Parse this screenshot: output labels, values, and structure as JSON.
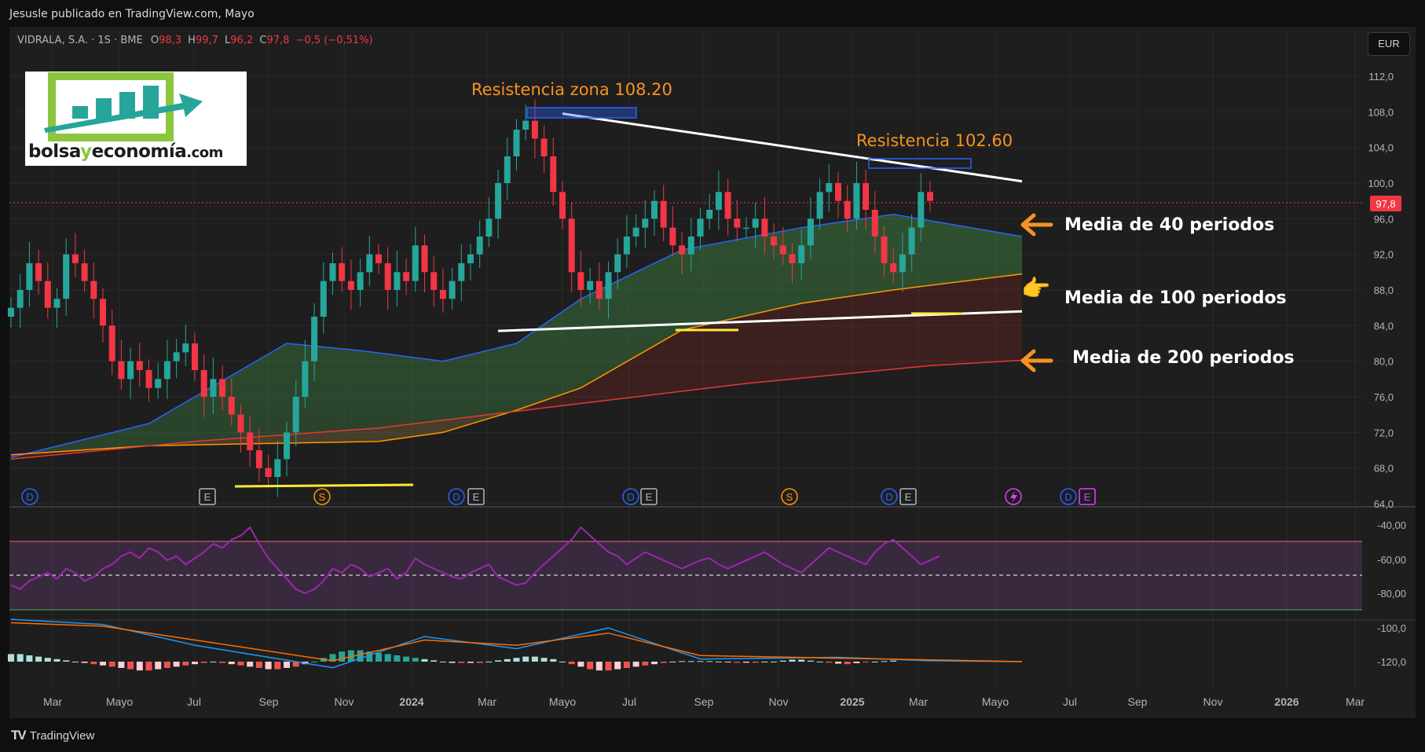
{
  "publisher_line": "Jesusle publicado en TradingView.com, Mayo",
  "brand": {
    "logo": "TV",
    "name": "TradingView"
  },
  "symbol_line": {
    "name": "VIDRALA, S.A. · 1S · BME",
    "o_label": "O",
    "o": "98,3",
    "h_label": "H",
    "h": "99,7",
    "l_label": "L",
    "l": "96,2",
    "c_label": "C",
    "c": "97,8",
    "chg": "−0,5 (−0,51%)"
  },
  "currency": "EUR",
  "logo": {
    "word1": "bolsa",
    "word2": "y",
    "word3": "economía",
    "word4": ".com"
  },
  "annotations": {
    "res1": "Resistencia zona 108.20",
    "res2": "Resistencia 102.60",
    "ma40": "Media de 40 periodos",
    "ma100": "Media de 100 periodos",
    "ma200": "Media de 200 periodos"
  },
  "colors": {
    "up": "#26a69a",
    "down": "#f23645",
    "ma40": "#2962ff",
    "ma100": "#ff9800",
    "ma200": "#e53935",
    "rsi": "#9c27b0",
    "macd": "#2196f3",
    "signal": "#ff6d00",
    "annotation": "#f7931e",
    "price_tag": "#f23645"
  },
  "chart_data": [
    {
      "type": "candlestick",
      "title": "VIDRALA, S.A. · 1S · BME",
      "last_price": "97,8",
      "y_axis": {
        "ticks": [
          "112,0",
          "108,0",
          "104,0",
          "100,0",
          "96,0",
          "92,0",
          "88,0",
          "84,0",
          "80,0",
          "76,0",
          "72,0",
          "68,0",
          "64,0"
        ],
        "range": [
          64,
          112
        ]
      },
      "x_axis": {
        "ticks": [
          "Mar",
          "Mayo",
          "Jul",
          "Sep",
          "Nov",
          "2024",
          "Mar",
          "Mayo",
          "Jul",
          "Sep",
          "Nov",
          "2025",
          "Mar",
          "Mayo",
          "Jul",
          "Sep",
          "Nov",
          "2026",
          "Mar"
        ],
        "bold": [
          "2024",
          "2025",
          "2026"
        ]
      },
      "closes": [
        86,
        88,
        91,
        89,
        86,
        87,
        92,
        91,
        89,
        87,
        84,
        80,
        78,
        80,
        79,
        77,
        78,
        80,
        81,
        82,
        79,
        76,
        78,
        76,
        74,
        72,
        70,
        68,
        67,
        69,
        72,
        76,
        80,
        85,
        89,
        91,
        89,
        88,
        90,
        92,
        91,
        88,
        90,
        89,
        93,
        90,
        88,
        87,
        89,
        91,
        92,
        94,
        96,
        100,
        103,
        106,
        107,
        105,
        103,
        99,
        96,
        90,
        88,
        89,
        87,
        90,
        92,
        94,
        95,
        96,
        98,
        95,
        93,
        92,
        94,
        96,
        97,
        99,
        96,
        95,
        95,
        96,
        94,
        93,
        92,
        91,
        93,
        96,
        99,
        100,
        98,
        96,
        100,
        97,
        94,
        91,
        90,
        92,
        95,
        99,
        98
      ],
      "moving_averages": [
        {
          "name": "MA 40",
          "points": [
            [
              0,
              69.2
            ],
            [
              15,
              73
            ],
            [
              30,
              82
            ],
            [
              38,
              81.2
            ],
            [
              47,
              80
            ],
            [
              55,
              82
            ],
            [
              62,
              87
            ],
            [
              73,
              92.5
            ],
            [
              86,
              95
            ],
            [
              96,
              96.5
            ],
            [
              110,
              94
            ]
          ]
        },
        {
          "name": "MA 100",
          "points": [
            [
              0,
              69.5
            ],
            [
              15,
              70.5
            ],
            [
              30,
              70.8
            ],
            [
              40,
              71
            ],
            [
              47,
              72
            ],
            [
              55,
              74.5
            ],
            [
              62,
              77
            ],
            [
              73,
              83.5
            ],
            [
              86,
              86.5
            ],
            [
              96,
              88
            ],
            [
              110,
              89.8
            ]
          ]
        },
        {
          "name": "MA 200",
          "points": [
            [
              0,
              69
            ],
            [
              20,
              71
            ],
            [
              40,
              72.5
            ],
            [
              60,
              75
            ],
            [
              80,
              77.5
            ],
            [
              100,
              79.5
            ],
            [
              110,
              80.1
            ]
          ]
        }
      ],
      "trendlines": [
        {
          "from": [
            60,
            107.8
          ],
          "to": [
            110,
            100.2
          ]
        },
        {
          "from": [
            53,
            83.4
          ],
          "to": [
            110,
            85.6
          ]
        }
      ],
      "event_markers": [
        "D",
        "E",
        "S",
        "D",
        "E",
        "D",
        "E",
        "S",
        "D",
        "E",
        "D",
        "E"
      ]
    },
    {
      "type": "line",
      "title": "RSI",
      "y_axis": {
        "ticks": [
          "-40,00",
          "-60,00",
          "-80,00"
        ]
      },
      "values": [
        42,
        40,
        44,
        46,
        48,
        45,
        50,
        48,
        44,
        46,
        50,
        52,
        56,
        58,
        55,
        60,
        58,
        54,
        56,
        52,
        55,
        58,
        62,
        60,
        64,
        66,
        70,
        62,
        55,
        50,
        45,
        40,
        38,
        40,
        44,
        50,
        48,
        52,
        50,
        46,
        48,
        50,
        45,
        48,
        55,
        52,
        50,
        48,
        46,
        45,
        48,
        50,
        52,
        46,
        44,
        42,
        43,
        48,
        52,
        56,
        60,
        64,
        70,
        66,
        62,
        58,
        56,
        52,
        55,
        58,
        56,
        54,
        52,
        50,
        52,
        54,
        55,
        52,
        50,
        52,
        54,
        56,
        58,
        55,
        52,
        50,
        48,
        52,
        56,
        60,
        58,
        56,
        54,
        52,
        58,
        62,
        64,
        60,
        56,
        52,
        54,
        56
      ]
    },
    {
      "type": "bar",
      "title": "MACD",
      "y_axis": {
        "ticks": [
          "-100,0",
          "-120,0"
        ]
      },
      "histogram": [
        3,
        3,
        2.5,
        2,
        1.5,
        1,
        0.5,
        0,
        -0.5,
        -1,
        -1.5,
        -2,
        -2.5,
        -3,
        -3.5,
        -3.5,
        -3,
        -2.5,
        -2,
        -1.5,
        -1,
        -0.5,
        0,
        -0.5,
        -1,
        -1.5,
        -2,
        -2.5,
        -3,
        -3,
        -2.5,
        -2,
        -1,
        0,
        1.5,
        3,
        4,
        4.5,
        4.5,
        4,
        3.5,
        3,
        2.5,
        2,
        1.5,
        1,
        0.5,
        0,
        -0.5,
        -0.5,
        -0.5,
        -0.5,
        0,
        0.5,
        1,
        1.5,
        2,
        2,
        1.5,
        1,
        0,
        -1,
        -2,
        -3,
        -3.5,
        -3.5,
        -3,
        -2.5,
        -2,
        -1.5,
        -1,
        -0.5,
        0,
        0.2,
        0.2,
        0.2,
        0.2,
        0,
        -0.2,
        -0.4,
        -0.4,
        -0.4,
        -0.2,
        0,
        0.4,
        0.8,
        0.8,
        0.4,
        0,
        -0.4,
        -0.8,
        -1,
        -0.6,
        -0.2,
        0,
        0.2,
        0.4
      ],
      "macd_line": [
        [
          0,
          -95
        ],
        [
          10,
          -98
        ],
        [
          20,
          -110
        ],
        [
          35,
          -123
        ],
        [
          45,
          -105
        ],
        [
          55,
          -112
        ],
        [
          65,
          -100
        ],
        [
          75,
          -118
        ],
        [
          90,
          -117
        ],
        [
          100,
          -119
        ],
        [
          110,
          -119.5
        ]
      ],
      "signal_line": [
        [
          0,
          -97
        ],
        [
          10,
          -99
        ],
        [
          20,
          -107
        ],
        [
          35,
          -119
        ],
        [
          45,
          -107
        ],
        [
          55,
          -110
        ],
        [
          65,
          -103
        ],
        [
          75,
          -116
        ],
        [
          90,
          -117.5
        ],
        [
          100,
          -118.5
        ],
        [
          110,
          -119.5
        ]
      ]
    }
  ]
}
